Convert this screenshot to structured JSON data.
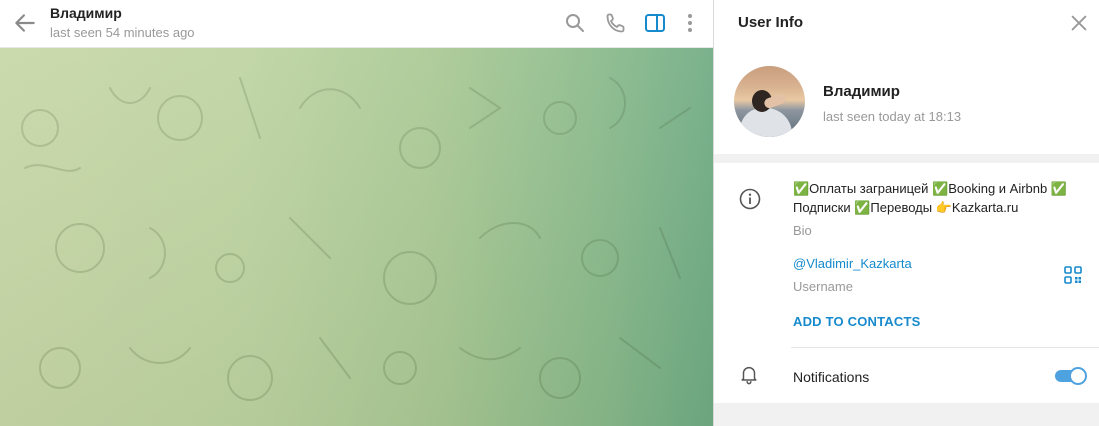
{
  "chat": {
    "title": "Владимир",
    "status": "last seen 54 minutes ago",
    "icons": [
      "back-arrow-icon",
      "search-icon",
      "phone-icon",
      "sidebar-toggle-icon",
      "more-vertical-icon"
    ],
    "accent": "#168acd"
  },
  "info_panel": {
    "title": "User Info",
    "name": "Владимир",
    "status": "last seen today at 18:13",
    "bio": "✅Оплаты заграницей ✅Booking и Airbnb ✅ Подписки ✅Переводы 👉Kazkarta.ru",
    "bio_label": "Bio",
    "username": "@Vladimir_Kazkarta",
    "username_label": "Username",
    "add_contacts": "ADD TO CONTACTS",
    "notifications_label": "Notifications",
    "notifications_enabled": true
  }
}
